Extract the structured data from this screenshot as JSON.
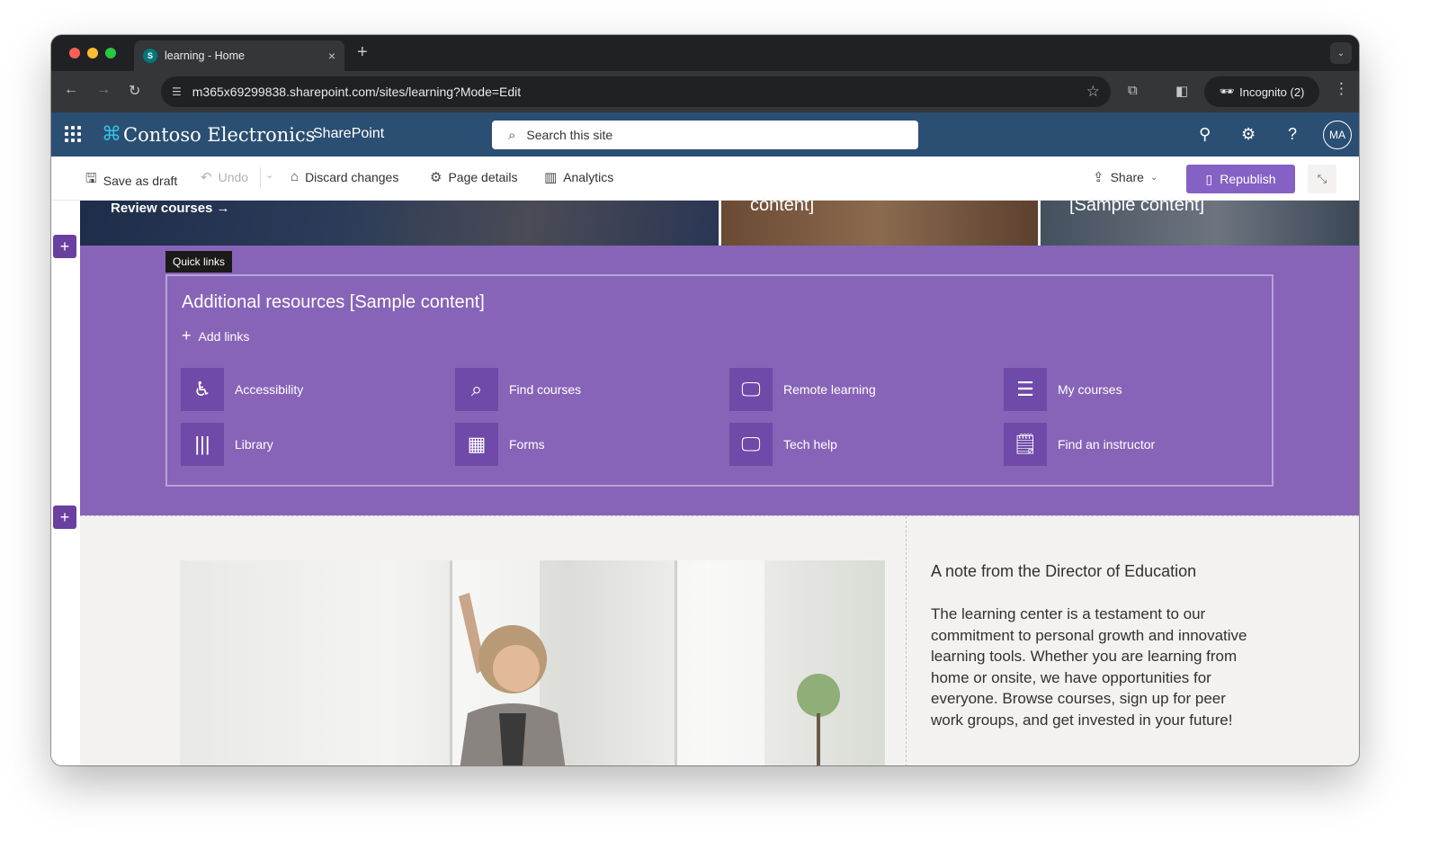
{
  "browser": {
    "tab_title": "learning - Home",
    "tab_close": "×",
    "new_tab": "+",
    "url": "m365x69299838.sharepoint.com/sites/learning?Mode=Edit",
    "incognito_label": "Incognito (2)"
  },
  "suitebar": {
    "org_name": "Contoso Electronics",
    "app_name": "SharePoint",
    "search_placeholder": "Search this site",
    "avatar_initials": "MA",
    "color": "#2b4f72"
  },
  "commands": {
    "save_draft": "Save as draft",
    "undo": "Undo",
    "discard": "Discard changes",
    "page_details": "Page details",
    "analytics": "Analytics",
    "share": "Share",
    "republish": "Republish",
    "accent": "#8561c5"
  },
  "hero": {
    "tile1_link": "Review courses →",
    "tile2_text": "content]",
    "tile3_text": "[Sample content]"
  },
  "quick_links": {
    "tag": "Quick links",
    "title": "Additional resources [Sample content]",
    "add_links": "Add links",
    "background": "#8764b8",
    "items": [
      {
        "label": "Accessibility",
        "icon": "accessibility-icon"
      },
      {
        "label": "Find courses",
        "icon": "search-icon"
      },
      {
        "label": "Remote learning",
        "icon": "monitor-check-icon"
      },
      {
        "label": "My courses",
        "icon": "checklist-icon"
      },
      {
        "label": "Library",
        "icon": "library-icon"
      },
      {
        "label": "Forms",
        "icon": "forms-icon"
      },
      {
        "label": "Tech help",
        "icon": "monitor-check-icon"
      },
      {
        "label": "Find an instructor",
        "icon": "notepad-icon"
      }
    ]
  },
  "note": {
    "title": "A note from the Director of Education",
    "body": "The learning center is a testament to our commitment to personal growth and innovative learning tools. Whether you are learning from home or onsite, we have opportunities for everyone. Browse courses, sign up for peer work groups, and get invested in your future!"
  }
}
